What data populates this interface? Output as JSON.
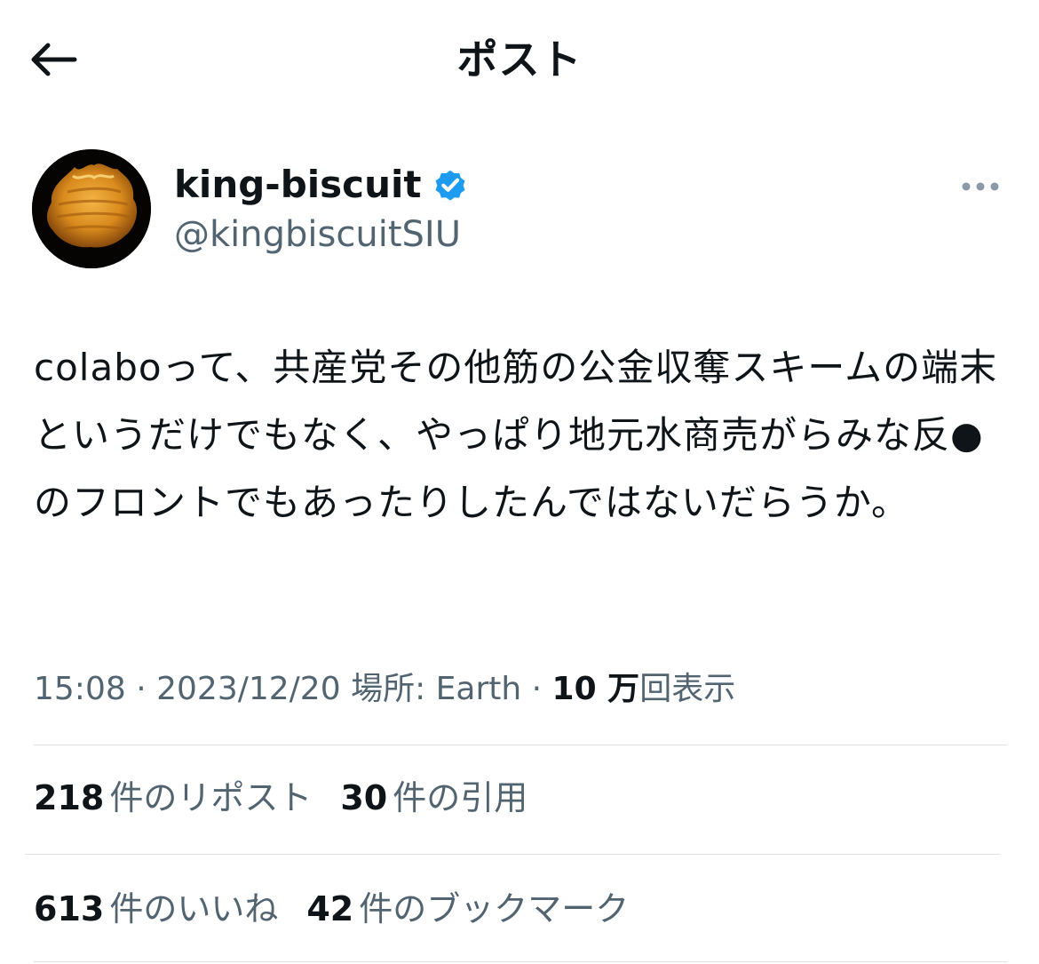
{
  "header": {
    "title": "ポスト",
    "back_icon": "arrow-left-icon"
  },
  "author": {
    "name": "king-biscuit",
    "handle": "@kingbiscuitSIU",
    "verified": true,
    "verified_color": "#1d9bf0",
    "more_icon": "ellipsis-icon"
  },
  "post": {
    "text": "colaboって、共産党その他筋の公金収奪スキームの端末というだけでもなく、やっぱり地元水商売がらみな反●のフロントでもあったりしたんではないだらうか。"
  },
  "meta": {
    "time": "15:08",
    "separator": "·",
    "date": "2023/12/20",
    "location_label": "場所: Earth",
    "views_count": "10 万",
    "views_label": "回表示"
  },
  "stats": {
    "reposts_count": "218",
    "reposts_label": "件のリポスト",
    "quotes_count": "30",
    "quotes_label": "件の引用",
    "likes_count": "613",
    "likes_label": "件のいいね",
    "bookmarks_count": "42",
    "bookmarks_label": "件のブックマーク"
  },
  "colors": {
    "text_primary": "#0f1419",
    "text_secondary": "#536471",
    "divider": "#dfe3e6"
  }
}
